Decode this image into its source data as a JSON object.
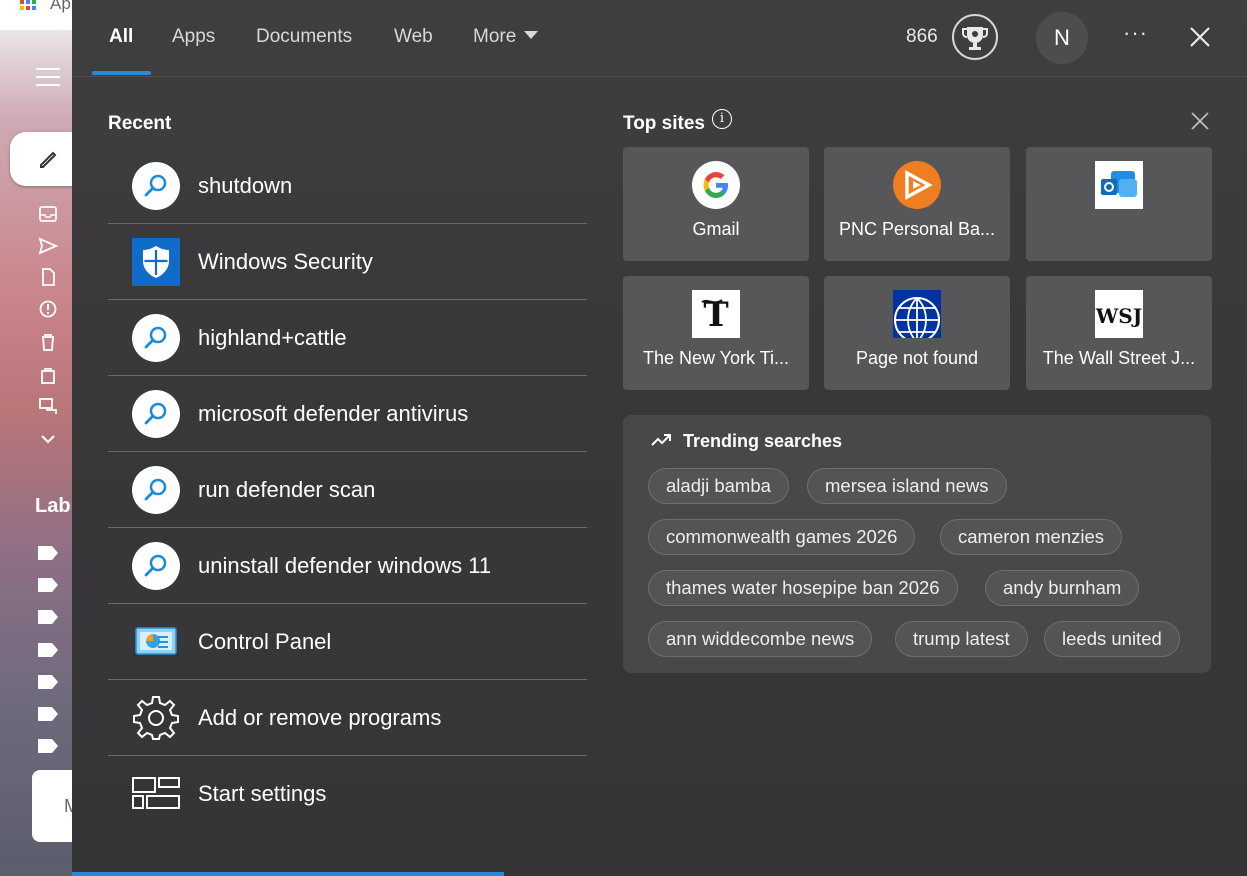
{
  "background_app": {
    "label": "Ap",
    "labels_heading": "Lab",
    "card_letter": "M"
  },
  "tabs": [
    {
      "label": "All",
      "active": true
    },
    {
      "label": "Apps"
    },
    {
      "label": "Documents"
    },
    {
      "label": "Web"
    },
    {
      "label": "More"
    }
  ],
  "header": {
    "points": "866",
    "avatar_initial": "N",
    "more_options": "···"
  },
  "recent": {
    "heading": "Recent",
    "items": [
      {
        "label": "shutdown",
        "icon": "search-icon"
      },
      {
        "label": "Windows Security",
        "icon": "windows-security-icon"
      },
      {
        "label": "highland+cattle",
        "icon": "search-icon"
      },
      {
        "label": "microsoft defender antivirus",
        "icon": "search-icon"
      },
      {
        "label": "run defender scan",
        "icon": "search-icon"
      },
      {
        "label": "uninstall defender windows 11",
        "icon": "search-icon"
      },
      {
        "label": "Control Panel",
        "icon": "control-panel-icon"
      },
      {
        "label": "Add or remove programs",
        "icon": "gear-icon"
      },
      {
        "label": "Start settings",
        "icon": "start-layout-icon"
      }
    ]
  },
  "top_sites": {
    "heading": "Top sites",
    "info": "i",
    "tiles": [
      {
        "label": "Gmail",
        "icon": "google-icon"
      },
      {
        "label": "PNC Personal Ba...",
        "icon": "pnc-icon"
      },
      {
        "label": "",
        "icon": "outlook-icon"
      },
      {
        "label": "The New York Ti...",
        "icon": "nyt-icon"
      },
      {
        "label": "Page not found",
        "icon": "united-globe-icon"
      },
      {
        "label": "The Wall Street J...",
        "icon": "wsj-icon"
      }
    ]
  },
  "trending": {
    "heading": "Trending searches",
    "chips": [
      "aladji bamba",
      "mersea island news",
      "commonwealth games 2026",
      "cameron menzies",
      "thames water hosepipe ban 2026",
      "andy burnham",
      "ann widdecombe news",
      "trump latest",
      "leeds united"
    ]
  },
  "colors": {
    "accent": "#2b88d9",
    "panel": "#3c3b3d",
    "tile": "#575658"
  }
}
